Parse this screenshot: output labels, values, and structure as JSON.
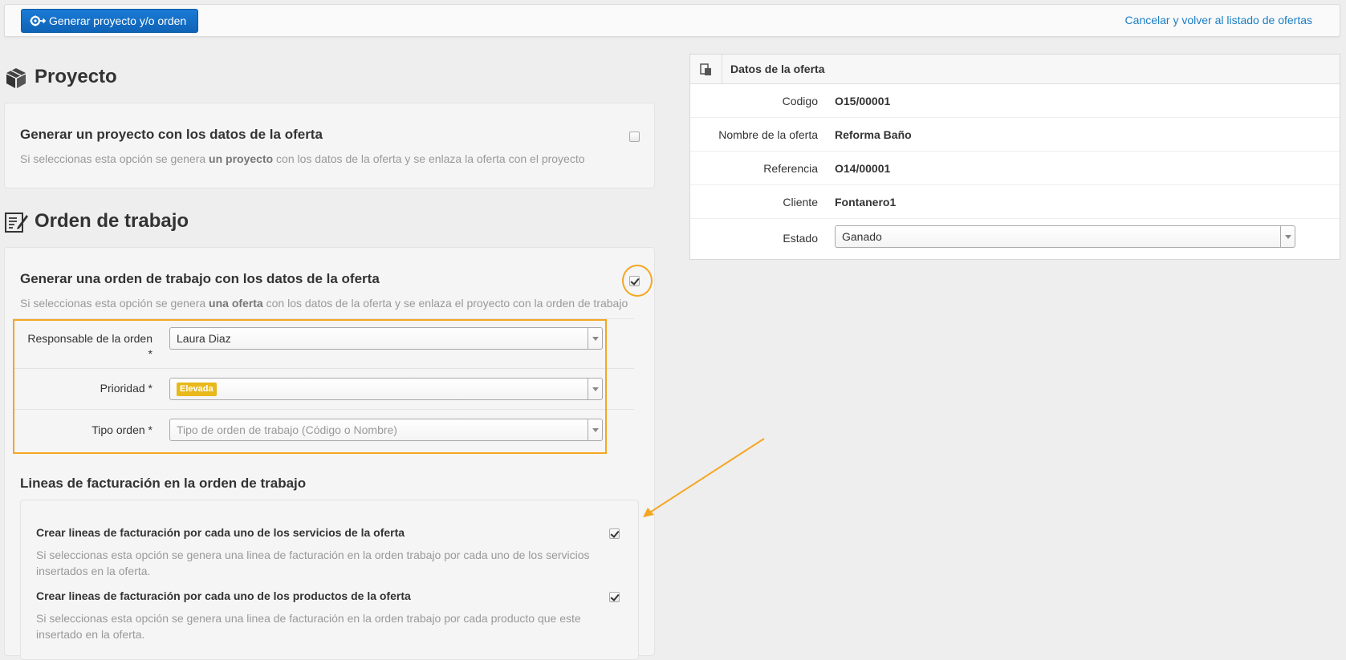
{
  "toolbar": {
    "generate_label": "Generar proyecto y/o orden",
    "cancel_label": "Cancelar y volver al listado de ofertas"
  },
  "project": {
    "title": "Proyecto",
    "option_title": "Generar un proyecto con los datos de la oferta",
    "desc_before": "Si seleccionas esta opción se genera ",
    "desc_bold": "un proyecto",
    "desc_after": " con los datos de la oferta y se enlaza la oferta con el proyecto",
    "checked": false
  },
  "work_order": {
    "title": "Orden de trabajo",
    "option_title": "Generar una orden de trabajo con los datos de la oferta",
    "desc_before": "Si seleccionas esta opción se genera ",
    "desc_bold": "una oferta",
    "desc_after": " con los datos de la oferta y se enlaza el proyecto con la orden de trabajo",
    "checked": true,
    "fields": {
      "responsable_label": "Responsable de la orden",
      "responsable_required": "*",
      "responsable_value": "Laura Diaz",
      "prioridad_label": "Prioridad *",
      "prioridad_value": "Elevada",
      "tipo_label": "Tipo orden *",
      "tipo_placeholder": "Tipo de orden de trabajo (Código o Nombre)"
    },
    "billing": {
      "title": "Lineas de facturación en la orden de trabajo",
      "services_title": "Crear lineas de facturación por cada uno de los servicios de la oferta",
      "services_desc": "Si seleccionas esta opción se genera una linea de facturación en la orden trabajo por cada uno de los servicios insertados en la oferta.",
      "services_checked": true,
      "products_title": "Crear lineas de facturación por cada uno de los productos de la oferta",
      "products_desc": "Si seleccionas esta opción se genera una linea de facturación en la orden trabajo por cada producto que este insertado en la oferta.",
      "products_checked": true
    }
  },
  "offer_panel": {
    "title": "Datos de la oferta",
    "rows": [
      {
        "label": "Codigo",
        "value": "O15/00001"
      },
      {
        "label": "Nombre de la oferta",
        "value": "Reforma Baño"
      },
      {
        "label": "Referencia",
        "value": "O14/00001"
      },
      {
        "label": "Cliente",
        "value": "Fontanero1"
      }
    ],
    "estado_label": "Estado",
    "estado_value": "Ganado"
  },
  "colors": {
    "primary": "#0e63b6",
    "link": "#1a7ec4",
    "highlight": "#f5a623",
    "priority_tag": "#e9b81a"
  }
}
